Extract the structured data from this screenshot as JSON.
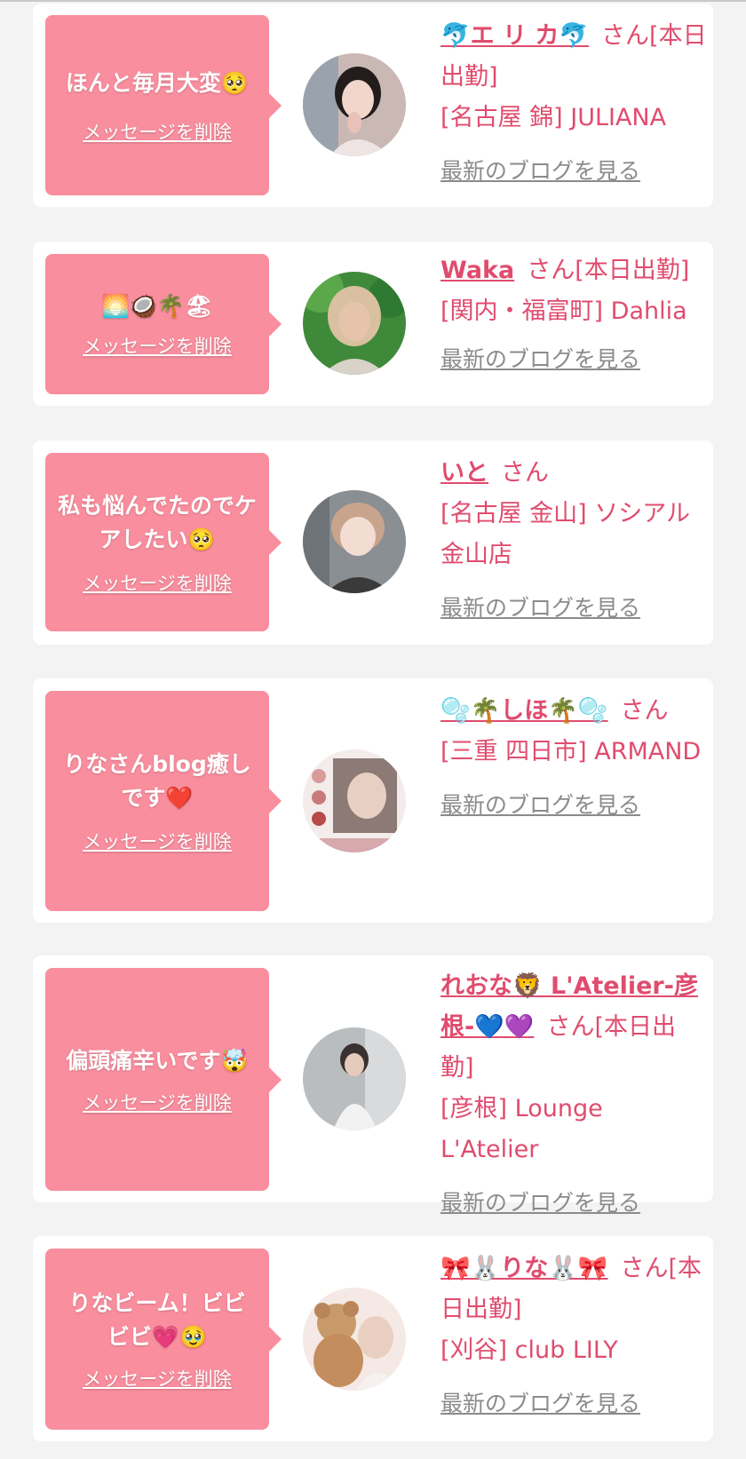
{
  "cards": [
    {
      "message": "ほんと毎月大変🥺",
      "delete_label": "メッセージを削除",
      "name": "🐬エ リ カ🐬",
      "suffix": "さん[本日出勤]",
      "shop": "[名古屋 錦] JULIANA",
      "blog_label": "最新のブログを見る"
    },
    {
      "message": "🌅🥥🌴🏖",
      "delete_label": "メッセージを削除",
      "name": "Waka",
      "suffix": "さん[本日出勤]",
      "shop": "[関内・福富町] Dahlia",
      "blog_label": "最新のブログを見る"
    },
    {
      "message": "私も悩んでたのでケアしたい🥺",
      "delete_label": "メッセージを削除",
      "name": "いと",
      "suffix": "さん",
      "shop": "[名古屋 金山] ソシアル金山店",
      "blog_label": "最新のブログを見る"
    },
    {
      "message": "りなさんblog癒しです❤️",
      "delete_label": "メッセージを削除",
      "name": "🫧🌴しほ🌴🫧",
      "suffix": "さん",
      "shop": "[三重 四日市] ARMAND",
      "blog_label": "最新のブログを見る"
    },
    {
      "message": "偏頭痛辛いです🤯",
      "delete_label": "メッセージを削除",
      "name": "れおな🦁 L'Atelier-彦根-💙💜",
      "suffix": "さん[本日出勤]",
      "shop": "[彦根] Lounge L'Atelier",
      "blog_label": "最新のブログを見る"
    },
    {
      "message": "りなビーム！ビビビビ💗🥹",
      "delete_label": "メッセージを削除",
      "name": "🎀🐰りな🐰🎀",
      "suffix": "さん[本日出勤]",
      "shop": "[刈谷] club LILY",
      "blog_label": "最新のブログを見る"
    }
  ]
}
